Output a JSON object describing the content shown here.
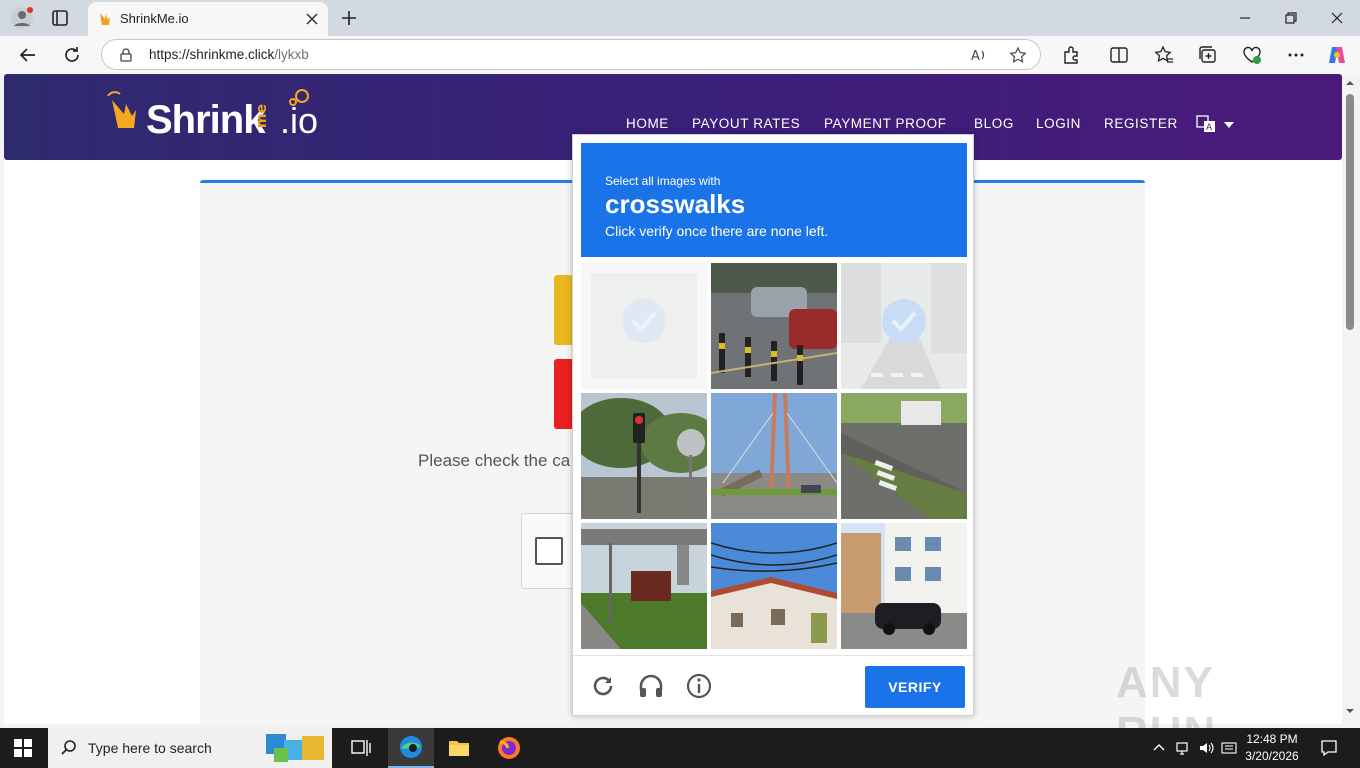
{
  "browser": {
    "tab_title": "ShrinkMe.io",
    "url_host": "https://shrinkme.click",
    "url_path": "/lykxb"
  },
  "site": {
    "logo_main": "Shrink",
    "logo_me": "me",
    "logo_io": ".io",
    "nav": [
      "HOME",
      "PAYOUT RATES",
      "PAYMENT PROOF",
      "BLOG",
      "LOGIN",
      "REGISTER"
    ],
    "card_text": "Please check the ca"
  },
  "captcha": {
    "line1": "Select all images with",
    "keyword": "crosswalks",
    "line3": "Click verify once there are none left.",
    "verify_label": "VERIFY",
    "tiles": [
      {
        "state": "selected",
        "scene": "blank"
      },
      {
        "state": "normal",
        "scene": "cars-bollards"
      },
      {
        "state": "selected",
        "scene": "street"
      },
      {
        "state": "normal",
        "scene": "traffic-light"
      },
      {
        "state": "normal",
        "scene": "bridge"
      },
      {
        "state": "normal",
        "scene": "crosswalk-bus"
      },
      {
        "state": "normal",
        "scene": "overpass"
      },
      {
        "state": "normal",
        "scene": "house-wires"
      },
      {
        "state": "normal",
        "scene": "city-car"
      }
    ]
  },
  "watermark": "ANY RUN",
  "taskbar": {
    "search_placeholder": "Type here to search",
    "time": "12:48 PM",
    "date": "3/20/2026"
  },
  "colors": {
    "accent": "#1a73e8",
    "header_start": "#2e2a6e",
    "header_end": "#4a1a7a"
  }
}
